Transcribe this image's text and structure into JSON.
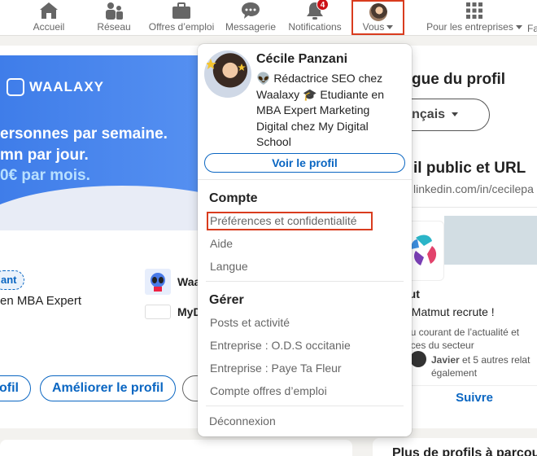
{
  "nav": {
    "items": [
      {
        "label": "Accueil",
        "icon": "home-icon"
      },
      {
        "label": "Réseau",
        "icon": "network-icon"
      },
      {
        "label": "Offres d’emploi",
        "icon": "briefcase-icon"
      },
      {
        "label": "Messagerie",
        "icon": "messaging-icon"
      },
      {
        "label": "Notifications",
        "icon": "bell-icon",
        "badge": "4"
      },
      {
        "label": "Vous",
        "icon": "avatar"
      },
      {
        "label": "Pour les entreprises",
        "icon": "grid-icon"
      }
    ],
    "overflow_text": "Fa"
  },
  "background_profile": {
    "banner_logo": "WAALAXY",
    "banner_lines": [
      "ersonnes par semaine.",
      "mn par jour.",
      "0€ par mois."
    ],
    "open_badge": "ant",
    "education_text": "en MBA Expert",
    "org1": "Waa",
    "org2": "MyD",
    "btn_profile_partial": "ofil",
    "btn_improve": "Améliorer le profil"
  },
  "right_column": {
    "title_lang": "gue du profil",
    "lang_value": "rançais",
    "title_url": "il public et URL",
    "url": "linkedin.com/in/cecilepa",
    "ad_company": "tut",
    "ad_hiring": ", Matmut recrute !",
    "ad_desc1": "au courant de l’actualité et",
    "ad_desc2": "nces du secteur",
    "ad_social_name": "Javier",
    "ad_social_rest": " et 5 autres relat",
    "ad_social_line2": "également",
    "ad_follow": "Suivre",
    "more_profiles": "Plus de profils à parcou"
  },
  "dropdown": {
    "name": "Cécile Panzani",
    "headline": "👽 Rédactrice SEO chez Waalaxy 🎓 Etudiante en MBA Expert Marketing Digital chez My Digital School",
    "view_profile": "Voir le profil",
    "section_account": "Compte",
    "account_items": [
      "Préférences et confidentialité",
      "Aide",
      "Langue"
    ],
    "section_manage": "Gérer",
    "manage_items": [
      "Posts et activité",
      "Entreprise : O.D.S occitanie",
      "Entreprise : Paye Ta Fleur",
      "Compte offres d’emploi"
    ],
    "logout": "Déconnexion"
  },
  "colors": {
    "linkedin_blue": "#0a66c2",
    "highlight_red": "#d93c1e",
    "banner_blue": "#4a89ee"
  }
}
